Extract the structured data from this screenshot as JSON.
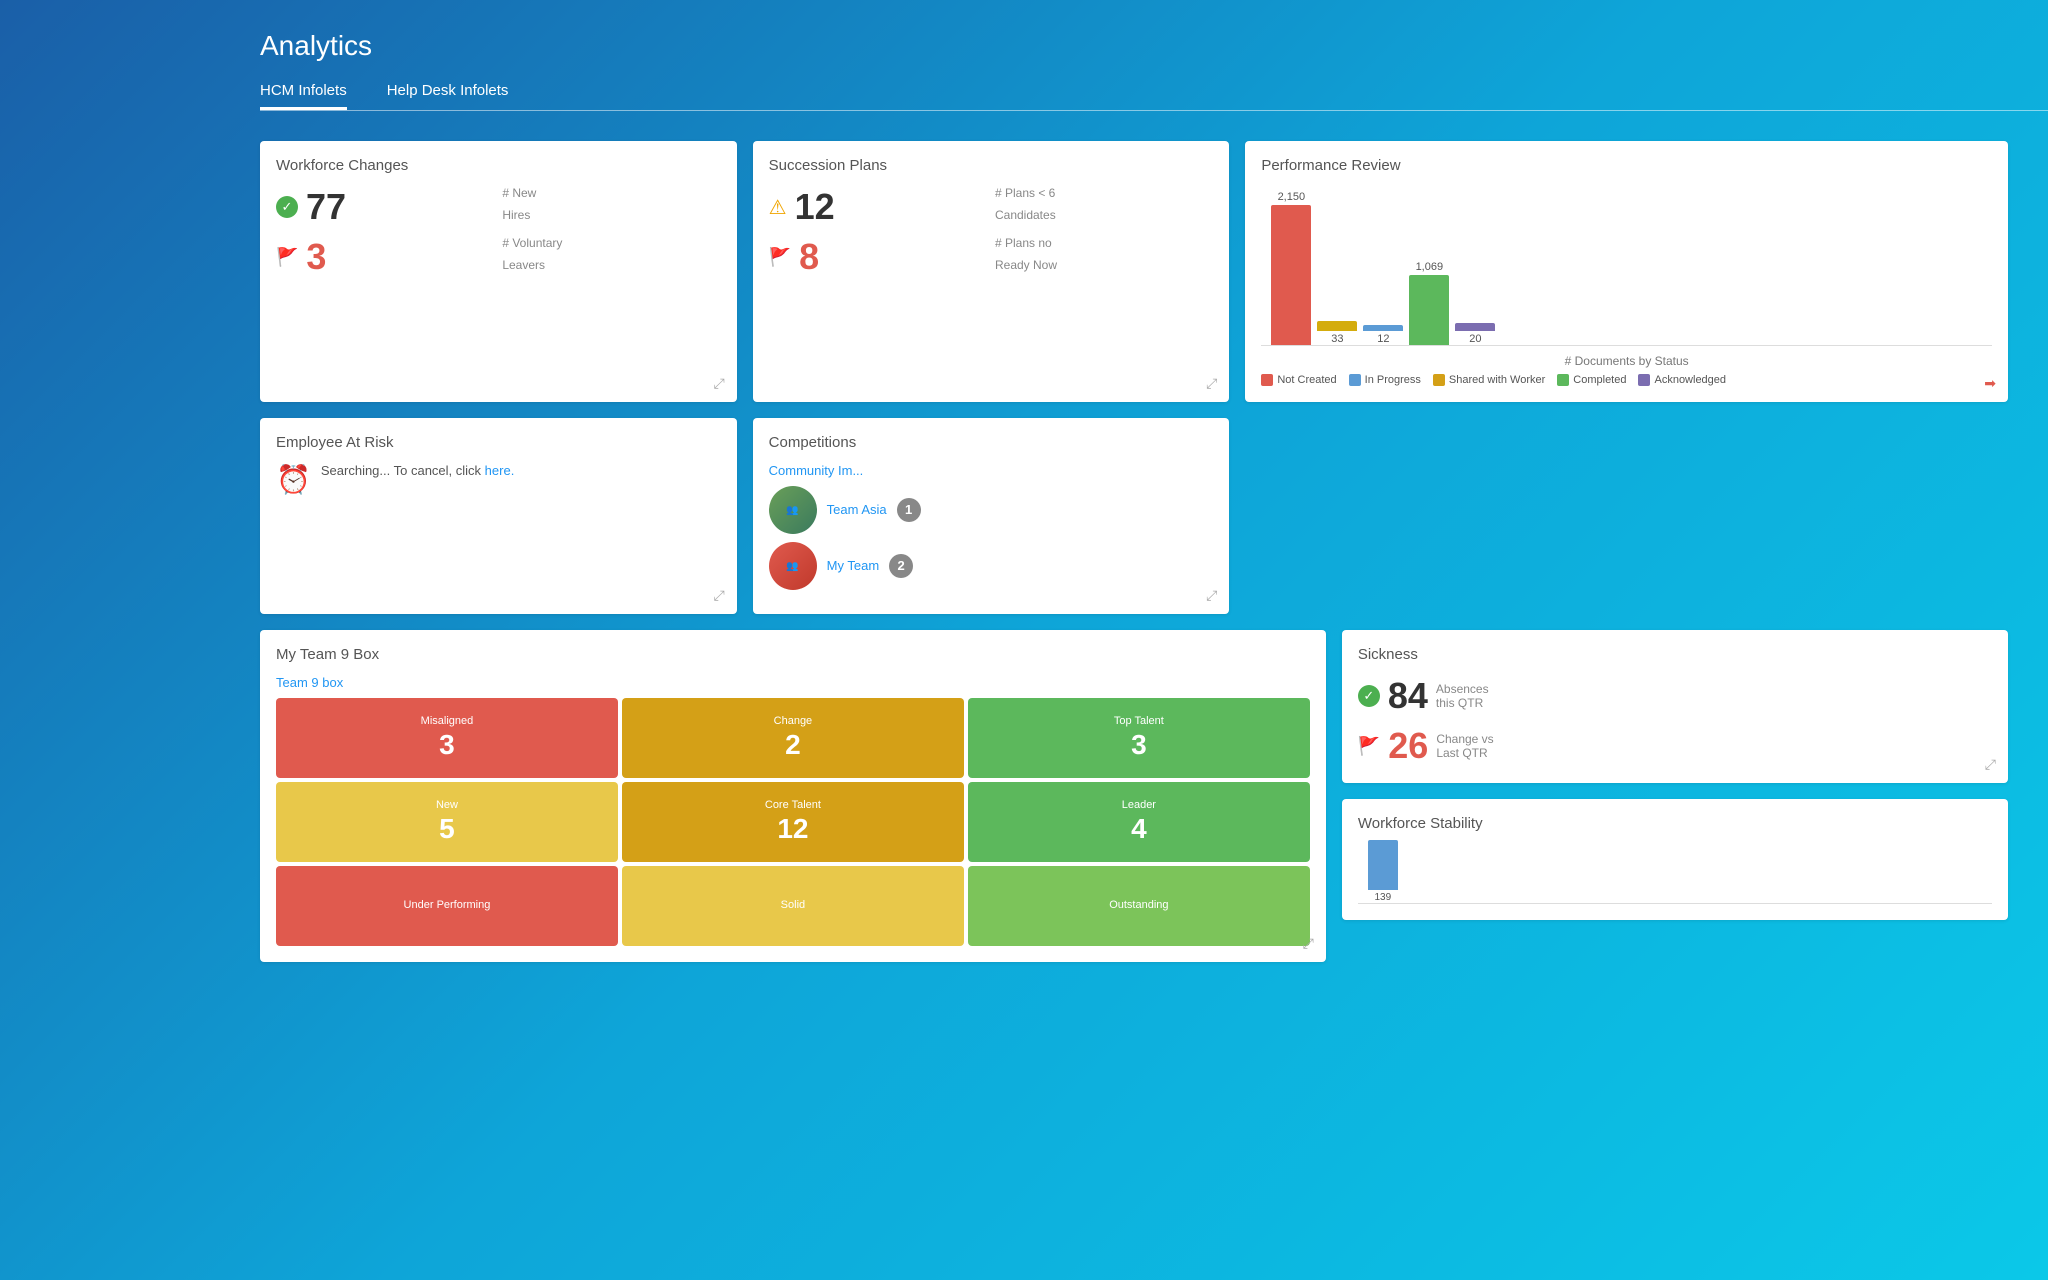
{
  "page": {
    "title": "Analytics"
  },
  "tabs": [
    {
      "id": "hcm",
      "label": "HCM Infolets",
      "active": true
    },
    {
      "id": "helpdesk",
      "label": "Help Desk Infolets",
      "active": false
    }
  ],
  "workforce_changes": {
    "title": "Workforce Changes",
    "items": [
      {
        "icon": "check",
        "number": "77",
        "label1": "# New",
        "label2": "Hires"
      },
      {
        "icon": "flag",
        "number": "3",
        "label1": "# Voluntary",
        "label2": "Leavers"
      }
    ]
  },
  "succession_plans": {
    "title": "Succession Plans",
    "items": [
      {
        "icon": "warn",
        "number": "12",
        "label1": "# Plans < 6",
        "label2": "Candidates"
      },
      {
        "icon": "flag",
        "number": "8",
        "label1": "# Plans no",
        "label2": "Ready Now"
      }
    ]
  },
  "performance_review": {
    "title": "Performance Review",
    "chart_title": "# Documents by Status",
    "bars": [
      {
        "label": "2,150",
        "value": 2150,
        "color": "red",
        "bottom": ""
      },
      {
        "label": "",
        "value": 33,
        "color": "gold",
        "bottom": "33"
      },
      {
        "label": "",
        "value": 12,
        "color": "blue",
        "bottom": "12"
      },
      {
        "label": "1,069",
        "value": 1069,
        "color": "green",
        "bottom": ""
      },
      {
        "label": "",
        "value": 20,
        "color": "gray",
        "bottom": "20"
      }
    ],
    "legend": [
      {
        "color": "#e05a4e",
        "label": "Not Created"
      },
      {
        "color": "#5b9bd5",
        "label": "In Progress"
      },
      {
        "color": "#d4a017",
        "label": "Shared with Worker"
      },
      {
        "color": "#5cb85c",
        "label": "Completed"
      },
      {
        "color": "#7b6db0",
        "label": "Acknowledged"
      }
    ]
  },
  "employee_at_risk": {
    "title": "Employee At Risk",
    "message": "Searching... To cancel, click ",
    "link_text": "here.",
    "clock_icon": "⏰"
  },
  "competitions": {
    "title": "Competitions",
    "link_label": "Community Im...",
    "teams": [
      {
        "name": "Team Asia",
        "rank": "1"
      },
      {
        "name": "My Team",
        "rank": "2"
      }
    ]
  },
  "my_team_9box": {
    "title": "My Team 9 Box",
    "link_label": "Team 9 box",
    "cells": [
      {
        "label": "Misaligned",
        "value": "3",
        "color": "red",
        "row": 0,
        "col": 0
      },
      {
        "label": "Change",
        "value": "2",
        "color": "yellow",
        "row": 0,
        "col": 1
      },
      {
        "label": "Top Talent",
        "value": "3",
        "color": "green",
        "row": 0,
        "col": 2
      },
      {
        "label": "New",
        "value": "5",
        "color": "yellow-light",
        "row": 1,
        "col": 0
      },
      {
        "label": "Core Talent",
        "value": "12",
        "color": "yellow",
        "row": 1,
        "col": 1
      },
      {
        "label": "Leader",
        "value": "4",
        "color": "green",
        "row": 1,
        "col": 2
      },
      {
        "label": "Under Performing",
        "value": "",
        "color": "red",
        "row": 2,
        "col": 0
      },
      {
        "label": "Solid",
        "value": "",
        "color": "yellow-light",
        "row": 2,
        "col": 1
      },
      {
        "label": "Outstanding",
        "value": "",
        "color": "green-light",
        "row": 2,
        "col": 2
      }
    ]
  },
  "sickness": {
    "title": "Sickness",
    "absences_number": "84",
    "absences_label1": "Absences",
    "absences_label2": "this QTR",
    "change_number": "26",
    "change_label1": "Change vs",
    "change_label2": "Last QTR"
  },
  "workforce_stability": {
    "title": "Workforce Stability",
    "bar_value": "139"
  }
}
